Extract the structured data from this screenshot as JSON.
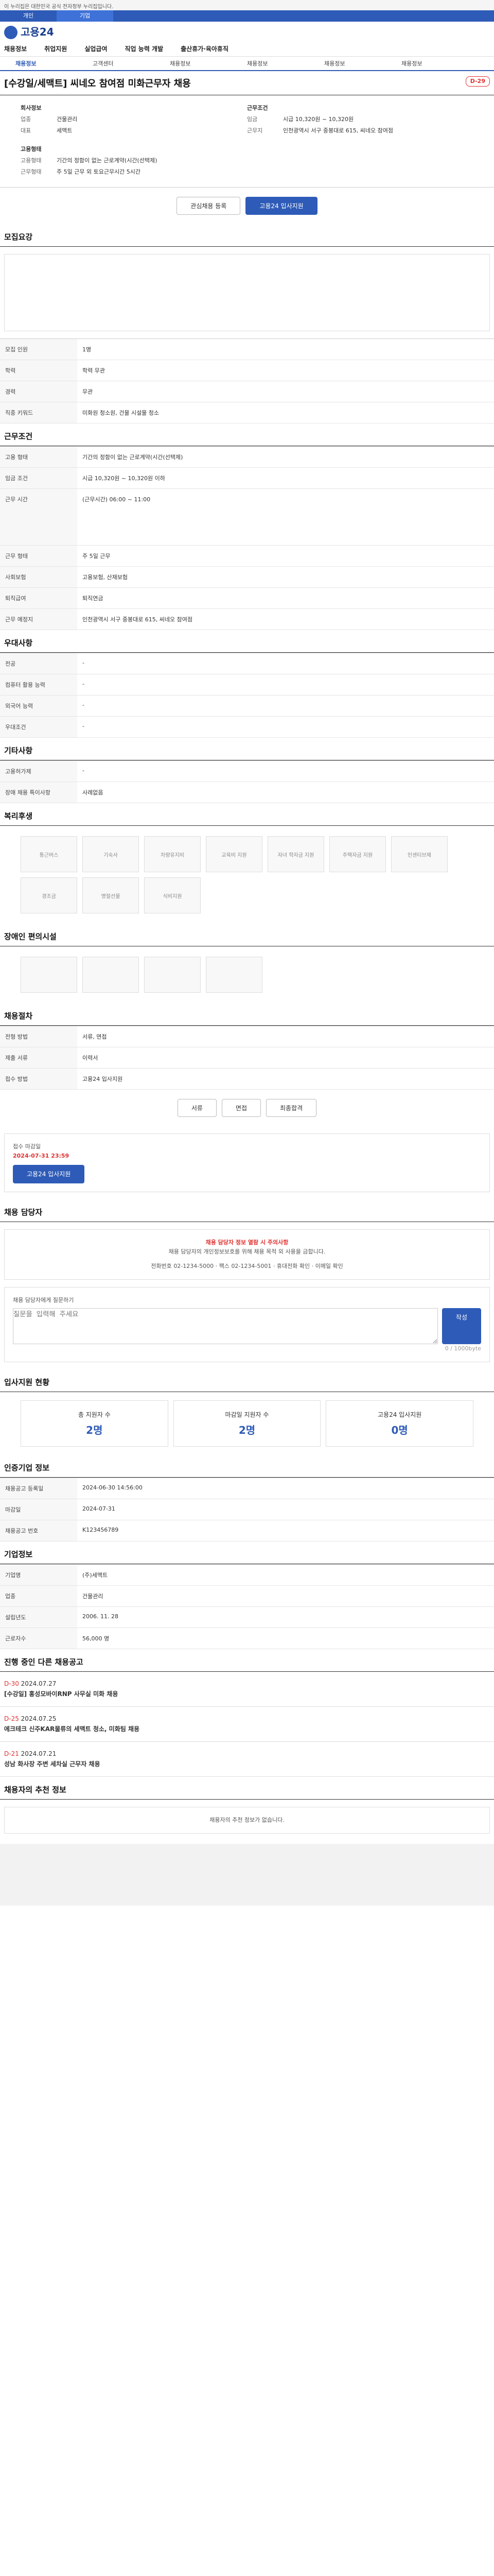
{
  "gov_banner": "이 누리집은 대한민국 공식 전자정부 누리집입니다.",
  "tabs": [
    "개인",
    "기업"
  ],
  "logo_text": "고용24",
  "nav": [
    "채용정보",
    "취업지원",
    "실업급여",
    "직업 능력 개발",
    "출산휴가·육아휴직"
  ],
  "subnav": [
    "채용정보",
    "고객센터",
    "채용정보",
    "채용정보",
    "채용정보",
    "채용정보"
  ],
  "job": {
    "title": "[수강일/세맥트] 씨네오 참여점 미화근무자 채용",
    "dday": "D-29",
    "company_label": "회사정보",
    "company_fields": [
      {
        "k": "업종",
        "v": "건물관리"
      },
      {
        "k": "대표",
        "v": "세맥트"
      }
    ],
    "condition_label": "근무조건",
    "condition_fields": [
      {
        "k": "임금",
        "v": "시급 10,320원 ~ 10,320원"
      },
      {
        "k": "근무지",
        "v": "인천광역시 서구 중봉대로 615, 씨네오 참여점"
      }
    ],
    "employment_label": "고용형태",
    "employment_fields": [
      {
        "k": "고용형태",
        "v": "기간의 정함이 없는 근로계약(시간(선택제)"
      },
      {
        "k": "근무형태",
        "v": "주 5일 근무 외 토요근무시간 5시간"
      }
    ],
    "btn_interest": "관심채용 등록",
    "btn_apply": "고용24 입사지원"
  },
  "sections": {
    "recruit": "모집요강",
    "conditions": "근무조건",
    "welfare": "우대사항",
    "etc": "기타사항",
    "welfare2": "복리후생",
    "disabled": "장애인 편의시설",
    "process": "채용절차",
    "contact": "채용 담당자",
    "statistics": "입사지원 현황",
    "info": "인증기업 정보",
    "company": "기업정보",
    "similar": "진행 중인 다른 채용공고",
    "recommend": "채용자의 추천 정보"
  },
  "recruit_rows": [
    {
      "k": "모집 인원",
      "v": "1명"
    },
    {
      "k": "학력",
      "v": "학력 무관"
    },
    {
      "k": "경력",
      "v": "무관"
    },
    {
      "k": "직종 키워드",
      "v": "미화원 청소원, 건물 시설물 청소"
    }
  ],
  "condition_rows": [
    {
      "k": "고용 형태",
      "v": "기간의 정함이 없는 근로계약(시간(선택제)"
    },
    {
      "k": "임금 조건",
      "v": "시급 10,320원 ~ 10,320원 이하"
    },
    {
      "k": "근무 시간",
      "v": "(근무시간) 06:00 ~ 11:00"
    },
    {
      "k": "근무 형태",
      "v": "주 5일 근무"
    },
    {
      "k": "사회보험",
      "v": "고용보험, 산재보험"
    },
    {
      "k": "퇴직급여",
      "v": "퇴직연금"
    },
    {
      "k": "근무 예정지",
      "v": "인천광역시 서구 중봉대로 615, 씨네오 참여점"
    }
  ],
  "welfare_rows": [
    {
      "k": "전공",
      "v": "-"
    },
    {
      "k": "컴퓨터 활용 능력",
      "v": "-"
    },
    {
      "k": "외국어 능력",
      "v": "-"
    },
    {
      "k": "우대조건",
      "v": "-"
    }
  ],
  "etc_rows": [
    {
      "k": "고용허가제",
      "v": "-"
    },
    {
      "k": "장애 채용 특이사항",
      "v": "사례없음"
    }
  ],
  "welfare_icons": [
    "통근버스",
    "기숙사",
    "차량유지비",
    "교육비 지원",
    "자녀 학자금 지원",
    "주택자금 지원",
    "인센티브제",
    "경조금",
    "명절선물",
    "식비지원"
  ],
  "process_rows": [
    {
      "k": "전형 방법",
      "v": "서류, 면접"
    },
    {
      "k": "제출 서류",
      "v": "이력서"
    },
    {
      "k": "접수 방법",
      "v": "고용24 입사지원"
    }
  ],
  "process_steps": [
    "서류",
    "면접",
    "최종합격"
  ],
  "deadline_label": "접수 마감일",
  "deadline": "2024-07-31 23:59",
  "contact": {
    "notice": "채용 담당자 정보 열람 시 주의사항",
    "desc": "채용 담당자의 개인정보보호를 위해 채용 목적 외 사용을 금합니다.",
    "rows": [
      {
        "k": "전화번호",
        "v": "02-1234-5000"
      },
      {
        "k": "팩스",
        "v": "02-1234-5001"
      },
      {
        "k": "휴대전화",
        "v": "확인"
      },
      {
        "k": "이메일",
        "v": "확인"
      }
    ],
    "inquiry_label": "채용 담당자에게 질문하기",
    "inquiry_placeholder": "질문을 입력해 주세요",
    "inquiry_count": "0 / 1000byte",
    "inquiry_btn": "작성"
  },
  "stats": [
    {
      "k": "총 지원자 수",
      "v": "2명"
    },
    {
      "k": "마감일 지원자 수",
      "v": "2명"
    },
    {
      "k": "고용24 입사지원",
      "v": "0명"
    }
  ],
  "info_rows": [
    {
      "k": "채용공고 등록일",
      "v": "2024-06-30 14:56:00"
    },
    {
      "k": "마감일",
      "v": "2024-07-31"
    },
    {
      "k": "채용공고 번호",
      "v": "K123456789"
    }
  ],
  "company_rows": [
    {
      "k": "기업명",
      "v": "(주)세맥트"
    },
    {
      "k": "업종",
      "v": "건물관리"
    },
    {
      "k": "설립년도",
      "v": "2006. 11. 28"
    },
    {
      "k": "근로자수",
      "v": "56,000 명"
    }
  ],
  "similar": [
    {
      "dday": "D-30",
      "date": "2024.07.27",
      "title": "[수강일] 홍성모바이RNP 사무실 미화 채용"
    },
    {
      "dday": "D-25",
      "date": "2024.07.25",
      "title": "에크테크 신주KAR물류의 세맥트 청소, 미화팀 채용"
    },
    {
      "dday": "D-21",
      "date": "2024.07.21",
      "title": "성남 화사장 주변 세차실 근무자 채용"
    }
  ],
  "recommend_text": "채용자의 추천 정보가 없습니다."
}
